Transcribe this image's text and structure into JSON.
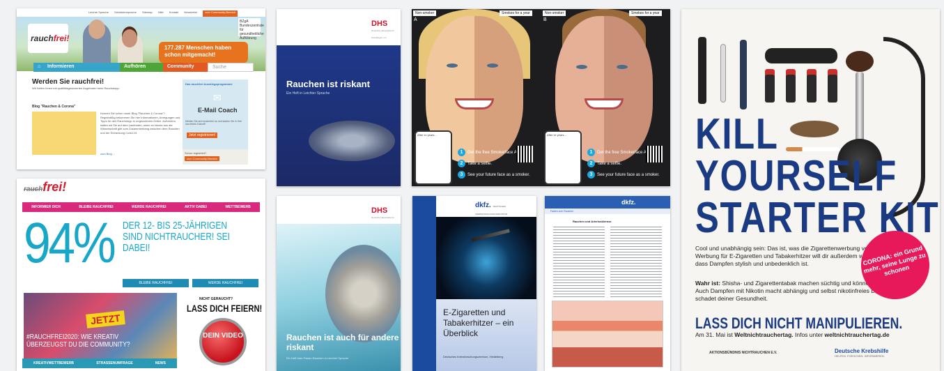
{
  "card1": {
    "topbar": [
      "Leichte Sprache",
      "Gebärdensprache",
      "Sitemap",
      "Hilfe",
      "Kontakt",
      "Newsletter"
    ],
    "topbar_button": "zum Community-Bereich",
    "logo_prefix": "rauch",
    "logo_suffix": "frei!",
    "bzga": "BZgA Bundeszentrale für gesundheitliche Aufklärung",
    "bubble": "177.287 Menschen haben schon mitgemacht!",
    "nav": [
      "Informieren",
      "Aufhören",
      "Community"
    ],
    "search_placeholder": "Suche",
    "heading": "Werden Sie rauchfrei!",
    "subheading": "Wir helfen Ihnen mit qualitätsgesicherten Angeboten beim Rauchstopp.",
    "blog_title": "Blog \"Rauchen & Corona\"",
    "blog_text": "Kennen Sie schon unser Blog \"Rauchen & Corona\"? Regelmäßig bekommen Sie hier Informationen, Anregungen und Tipps für den Rauchstopp in ungewohnten Zeiten. Außerdem halten wir Sie auf dem Laufenden, wenn es Neues aus der Wissenschaft gibt zum Zusammenhang zwischen dem Rauchen und der Erkrankung Covid-19.",
    "blog_link": "zum Blog ...",
    "side_heading": "Das rauchfrei Ausstiegsprogramme",
    "side_title": "E-Mail Coach",
    "side_text": "Melden Sie sich kostenfrei an und starten Sie in Ihre rauchfreie Zukunft!",
    "register": "Jetzt registrieren!",
    "already": "Schon registriert?",
    "community_button": "zum Community-Bereich"
  },
  "card2": {
    "logo_strike": "rauch",
    "logo": "frei!",
    "nav": [
      "INFORMIER DICH",
      "BLEIBE RAUCHFREI",
      "WERDE RAUCHFREI",
      "AKTIV DABEI",
      "WETTBEWERB"
    ],
    "big_number": "94%",
    "claim": "DER 12- BIS 25-JÄHRIGEN SIND NICHTRAUCHER! SEI DABEI!",
    "btn1": "BLEIBE RAUCHFREI",
    "btn2": "WERDE RAUCHFREI",
    "jetzt": "JETZT",
    "hashtag": "#RAUCHFREI2020: WIE KREATIV ÜBERZEUGST DU DIE COMMUNITY?",
    "nicht": "NICHT GERAUCHT?",
    "lass": "LASS DICH FEIERN!",
    "video": "DEIN VIDEO",
    "tabs": [
      "KREATIVWETTBEWERB",
      "STRASSENUMFRAGE",
      "NEWS"
    ]
  },
  "card3": {
    "brand": "DHS",
    "brand_sub": "Deutsche Hauptstelle für Suchtfragen e.V.",
    "title": "Rauchen ist riskant",
    "subtitle": "Ein Heft in Leichter Sprache"
  },
  "card4": {
    "brand": "DHS",
    "brand_sub": "Deutsche Hauptstelle für Suchtfragen e.V.",
    "title": "Rauchen ist auch für andere riskant",
    "subtitle": "Ein Heft über Passiv-Rauchen in Leichter Sprache"
  },
  "card5": {
    "left_label": "Non-smoker",
    "right_label": "Smokes for a year",
    "after": "After xx years...",
    "steps": [
      {
        "n": "1",
        "text": "Get the free Smokerface App"
      },
      {
        "n": "2",
        "text": "Take a selfie."
      },
      {
        "n": "3",
        "text": "See your future face as a smoker."
      }
    ],
    "panel_a": "A",
    "panel_b": "B"
  },
  "card6": {
    "brand": "dkfz.",
    "brand_sub": "DEUTSCHES KREBSFORSCHUNGSZENTRUM",
    "title": "E-Zigaretten und Tabakerhitzer – ein Überblick",
    "footer": "Deutsches Krebsforschungszentrum, Heidelberg"
  },
  "card7": {
    "brand": "dkfz.",
    "strip": "Fakten zum Rauchen",
    "heading": "Rauchen und Arteriosklerose"
  },
  "card8": {
    "headline": [
      "KILL",
      "YOURSELF",
      "STARTER KIT"
    ],
    "text": "Cool und unabhängig sein: Das ist, was die Zigarettenwerbung verspricht. Werbung für E-Zigaretten und Tabakerhitzer will dir außerdem weismachen, dass Dampfen stylish und unbedenklich ist.",
    "warn_bold": "Wahr ist:",
    "warn": "Shisha- und Zigarettentabak machen süchtig und können dich töten. Auch Dampfen mit Nikotin macht abhängig und selbst nikotinfreies Dampfen schadet deiner Gesundheit.",
    "slogan": "LASS DICH NICHT MANIPULIEREN.",
    "date_text": "Am 31. Mai ist",
    "date_bold": "Weltnichtrauchertag.",
    "date_info": "Infos unter",
    "date_url": "weltnichtrauchertag.de",
    "corona": "CORONA: ein Grund mehr, seine Lunge zu schonen",
    "foot1": "AKTIONSBÜNDNIS NICHTRAUCHEN E.V.",
    "foot2": "Deutsche Krebshilfe",
    "foot2_sub": "HELFEN. FORSCHEN. INFORMIEREN."
  }
}
